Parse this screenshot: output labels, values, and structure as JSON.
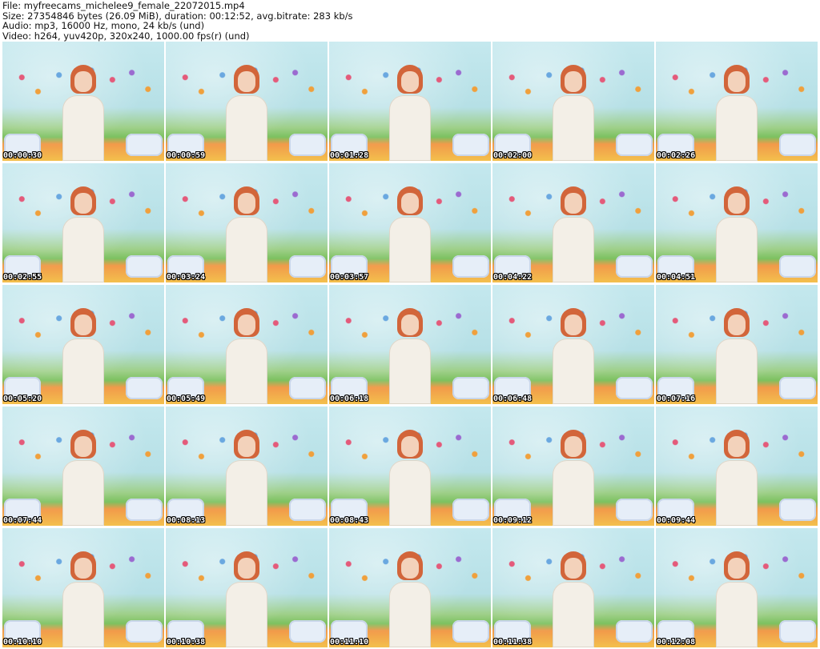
{
  "info": {
    "file": "File: myfreecams_michelee9_female_22072015.mp4",
    "size": "Size: 27354846 bytes (26.09 MiB), duration: 00:12:52, avg.bitrate: 283 kb/s",
    "audio": "Audio: mp3, 16000 Hz, mono, 24 kb/s (und)",
    "video": "Video: h264, yuv420p, 320x240, 1000.00 fps(r) (und)"
  },
  "thumbnails": [
    {
      "timestamp": "00:00:30"
    },
    {
      "timestamp": "00:00:59"
    },
    {
      "timestamp": "00:01:28"
    },
    {
      "timestamp": "00:02:00"
    },
    {
      "timestamp": "00:02:26"
    },
    {
      "timestamp": "00:02:55"
    },
    {
      "timestamp": "00:03:24"
    },
    {
      "timestamp": "00:03:57"
    },
    {
      "timestamp": "00:04:22"
    },
    {
      "timestamp": "00:04:51"
    },
    {
      "timestamp": "00:05:20"
    },
    {
      "timestamp": "00:05:49"
    },
    {
      "timestamp": "00:06:18"
    },
    {
      "timestamp": "00:06:48"
    },
    {
      "timestamp": "00:07:16"
    },
    {
      "timestamp": "00:07:44"
    },
    {
      "timestamp": "00:08:13"
    },
    {
      "timestamp": "00:08:43"
    },
    {
      "timestamp": "00:09:12"
    },
    {
      "timestamp": "00:09:44"
    },
    {
      "timestamp": "00:10:10"
    },
    {
      "timestamp": "00:10:38"
    },
    {
      "timestamp": "00:11:10"
    },
    {
      "timestamp": "00:11:38"
    },
    {
      "timestamp": "00:12:08"
    }
  ]
}
